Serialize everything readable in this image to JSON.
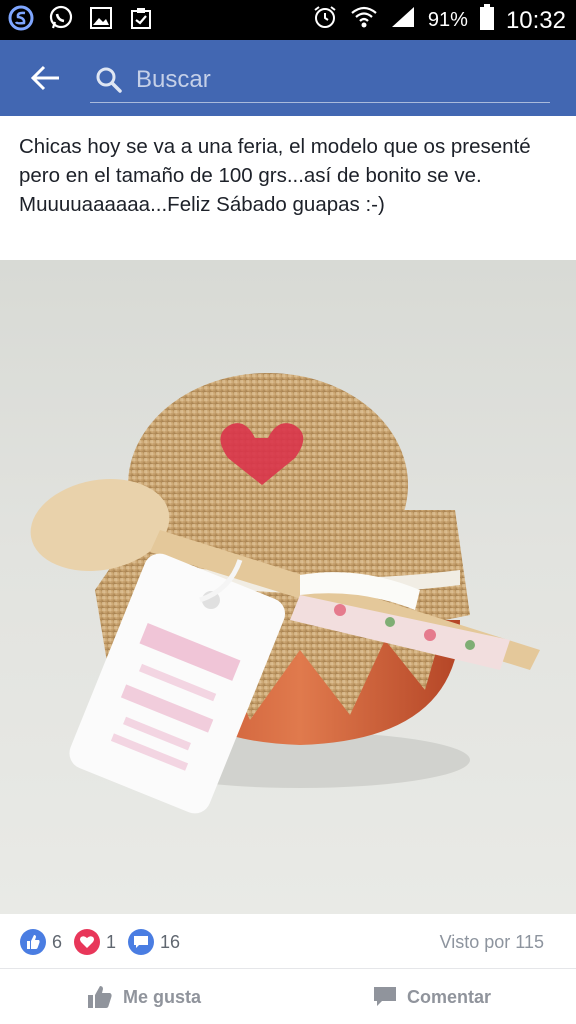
{
  "status_bar": {
    "battery": "91%",
    "time": "10:32"
  },
  "app_bar": {
    "search_placeholder": "Buscar"
  },
  "post": {
    "text_lines": [
      "Chicas hoy se va a una feria, el modelo que os presenté pero en el tamaño de 100 grs...así de bonito se ve.",
      "Muuuuaaaaaa...Feliz Sábado guapas :-)"
    ]
  },
  "reactions": {
    "like_count": "6",
    "love_count": "1",
    "comment_count": "16",
    "views": "Visto por 115"
  },
  "actions": {
    "like_label": "Me gusta",
    "comment_label": "Comentar"
  },
  "colors": {
    "brand": "#4267b2",
    "like": "#4a7de2",
    "love": "#e8375a"
  }
}
